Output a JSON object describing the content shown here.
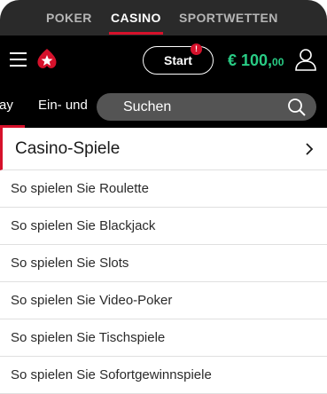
{
  "top_nav": {
    "tabs": [
      {
        "label": "POKER"
      },
      {
        "label": "CASINO"
      },
      {
        "label": "SPORTWETTEN"
      }
    ]
  },
  "header": {
    "start_label": "Start",
    "badge": "!",
    "balance_main": "€ 100,",
    "balance_cents": "00",
    "accent_color": "#d6112b",
    "balance_color": "#29cc85"
  },
  "sub_nav": {
    "items": [
      {
        "label": "ay"
      },
      {
        "label": "Ein- und"
      }
    ]
  },
  "search": {
    "placeholder": "Suchen"
  },
  "list": {
    "header": "Casino-Spiele",
    "items": [
      {
        "label": "So spielen Sie Roulette"
      },
      {
        "label": "So spielen Sie Blackjack"
      },
      {
        "label": "So spielen Sie Slots"
      },
      {
        "label": "So spielen Sie Video-Poker"
      },
      {
        "label": "So spielen Sie Tischspiele"
      },
      {
        "label": "So spielen Sie Sofortgewinnspiele"
      }
    ]
  }
}
